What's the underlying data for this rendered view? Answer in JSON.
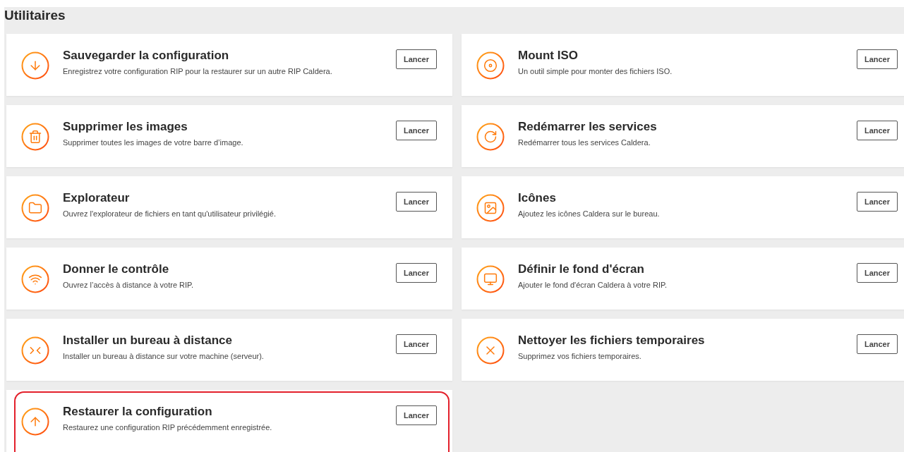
{
  "section": {
    "title": "Utilitaires"
  },
  "tools": [
    {
      "kind": "download",
      "title": "Sauvegarder la configuration",
      "description": "Enregistrez votre configuration RIP pour la restaurer sur un autre RIP Caldera.",
      "button": "Lancer",
      "highlighted": false
    },
    {
      "kind": "disc",
      "title": "Mount ISO",
      "description": "Un outil simple pour monter des fichiers ISO.",
      "button": "Lancer",
      "highlighted": false
    },
    {
      "kind": "trash",
      "title": "Supprimer les images",
      "description": "Supprimer toutes les images de votre barre d’image.",
      "button": "Lancer",
      "highlighted": false
    },
    {
      "kind": "refresh",
      "title": "Redémarrer les services",
      "description": "Redémarrer tous les services Caldera.",
      "button": "Lancer",
      "highlighted": false
    },
    {
      "kind": "folder",
      "title": "Explorateur",
      "description": "Ouvrez l'explorateur de fichiers en tant qu'utilisateur privilégié.",
      "button": "Lancer",
      "highlighted": false
    },
    {
      "kind": "image",
      "title": "Icônes",
      "description": "Ajoutez les icônes Caldera sur le bureau.",
      "button": "Lancer",
      "highlighted": false
    },
    {
      "kind": "wifi",
      "title": "Donner le contrôle",
      "description": "Ouvrez l’accès à distance à votre RIP.",
      "button": "Lancer",
      "highlighted": false
    },
    {
      "kind": "monitor",
      "title": "Définir le fond d'écran",
      "description": "Ajouter le fond d'écran Caldera à votre RIP.",
      "button": "Lancer",
      "highlighted": false
    },
    {
      "kind": "remote",
      "title": "Installer un bureau à distance",
      "description": "Installer un bureau à distance sur votre machine (serveur).",
      "button": "Lancer",
      "highlighted": false
    },
    {
      "kind": "close",
      "title": "Nettoyer les fichiers temporaires",
      "description": "Supprimez vos fichiers temporaires.",
      "button": "Lancer",
      "highlighted": false
    },
    {
      "kind": "upload",
      "title": "Restaurer la configuration",
      "description": "Restaurez une configuration RIP précédemment enregistrée.",
      "button": "Lancer",
      "highlighted": true
    }
  ]
}
